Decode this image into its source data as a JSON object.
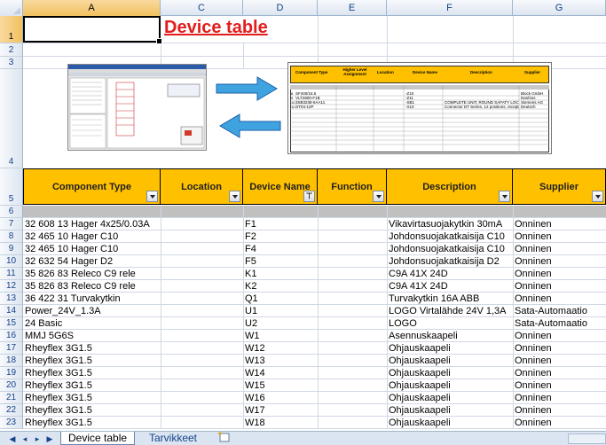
{
  "spreadsheet": {
    "column_headers": [
      "A",
      "C",
      "D",
      "E",
      "F",
      "G"
    ],
    "title": "Device table",
    "row_numbers": [
      "1",
      "2",
      "3",
      "4",
      "5",
      "6",
      "7",
      "8",
      "9",
      "10",
      "11",
      "12",
      "13",
      "14",
      "15",
      "16",
      "17",
      "18",
      "19",
      "20",
      "21",
      "22",
      "23"
    ],
    "header_cells": [
      "Component Type",
      "Location",
      "Device Name",
      "Function",
      "Description",
      "Supplier"
    ],
    "rows": [
      {
        "component_type": "32 608 13 Hager 4x25/0.03A",
        "location": "",
        "device_name": "F1",
        "function": "",
        "description": "Vikavirtasuojakytkin 30mA",
        "supplier": "Onninen"
      },
      {
        "component_type": "32 465 10  Hager C10",
        "location": "",
        "device_name": "F2",
        "function": "",
        "description": "Johdonsuojakatkaisija C10",
        "supplier": "Onninen"
      },
      {
        "component_type": "32 465 10  Hager C10",
        "location": "",
        "device_name": "F4",
        "function": "",
        "description": "Johdonsuojakatkaisija C10",
        "supplier": "Onninen"
      },
      {
        "component_type": "32 632 54 Hager D2",
        "location": "",
        "device_name": "F5",
        "function": "",
        "description": "Johdonsuojakatkaisija D2",
        "supplier": "Onninen"
      },
      {
        "component_type": "35 826 83 Releco C9 rele",
        "location": "",
        "device_name": "K1",
        "function": "",
        "description": "C9A 41X 24D",
        "supplier": "Onninen"
      },
      {
        "component_type": "35 826 83 Releco C9 rele",
        "location": "",
        "device_name": "K2",
        "function": "",
        "description": "C9A 41X 24D",
        "supplier": "Onninen"
      },
      {
        "component_type": "36 422 31 Turvakytkin",
        "location": "",
        "device_name": "Q1",
        "function": "",
        "description": "Turvakytkin 16A ABB",
        "supplier": "Onninen"
      },
      {
        "component_type": "Power_24V_1.3A",
        "location": "",
        "device_name": "U1",
        "function": "",
        "description": "LOGO Virtalähde 24V 1,3A",
        "supplier": "Sata-Automaatio"
      },
      {
        "component_type": "24 Basic",
        "location": "",
        "device_name": "U2",
        "function": "",
        "description": "LOGO",
        "supplier": "Sata-Automaatio"
      },
      {
        "component_type": "MMJ 5G6S",
        "location": "",
        "device_name": "W1",
        "function": "",
        "description": "Asennuskaapeli",
        "supplier": "Onninen"
      },
      {
        "component_type": "Rheyflex 3G1.5",
        "location": "",
        "device_name": "W12",
        "function": "",
        "description": "Ohjauskaapeli",
        "supplier": "Onninen"
      },
      {
        "component_type": "Rheyflex 3G1.5",
        "location": "",
        "device_name": "W13",
        "function": "",
        "description": "Ohjauskaapeli",
        "supplier": "Onninen"
      },
      {
        "component_type": "Rheyflex 3G1.5",
        "location": "",
        "device_name": "W14",
        "function": "",
        "description": "Ohjauskaapeli",
        "supplier": "Onninen"
      },
      {
        "component_type": "Rheyflex 3G1.5",
        "location": "",
        "device_name": "W15",
        "function": "",
        "description": "Ohjauskaapeli",
        "supplier": "Onninen"
      },
      {
        "component_type": "Rheyflex 3G1.5",
        "location": "",
        "device_name": "W16",
        "function": "",
        "description": "Ohjauskaapeli",
        "supplier": "Onninen"
      },
      {
        "component_type": "Rheyflex 3G1.5",
        "location": "",
        "device_name": "W17",
        "function": "",
        "description": "Ohjauskaapeli",
        "supplier": "Onninen"
      },
      {
        "component_type": "Rheyflex 3G1.5",
        "location": "",
        "device_name": "W18",
        "function": "",
        "description": "Ohjauskaapeli",
        "supplier": "Onninen"
      }
    ]
  },
  "embedded_table_image": {
    "headers": [
      "Component Type",
      "Higher Level Assignment",
      "Location",
      "Device Name",
      "Description",
      "Supplier"
    ],
    "row_numbers": [
      "5",
      "6",
      "7",
      "8",
      "9",
      "10",
      "11"
    ],
    "rows": [
      {
        "component_type": "SF400/16.5",
        "device_name": "-Z10",
        "description": "",
        "supplier": "Block GmbH"
      },
      {
        "component_type": "VLT2800-F1B",
        "device_name": "-Z11",
        "description": "",
        "supplier": "Danfoss"
      },
      {
        "component_type": "3SB3238-6AA11",
        "device_name": "-SB1",
        "description": "COMPLETE UNIT, ROUND SAFATY LOCK",
        "supplier": "Siemens AG"
      },
      {
        "component_type": "DT04-12P",
        "device_name": "-X10",
        "description": "Connector DT Series, 12 positions, receptacle",
        "supplier": "Deutsch"
      }
    ]
  },
  "arrow_color": "#3fa3e0",
  "tabs": [
    "Device table",
    "Tarvikkeet"
  ],
  "icons": [
    "first-sheet-icon",
    "prev-sheet-icon",
    "next-sheet-icon",
    "last-sheet-icon",
    "insert-sheet-icon",
    "filter-icon",
    "dropdown-icon"
  ]
}
